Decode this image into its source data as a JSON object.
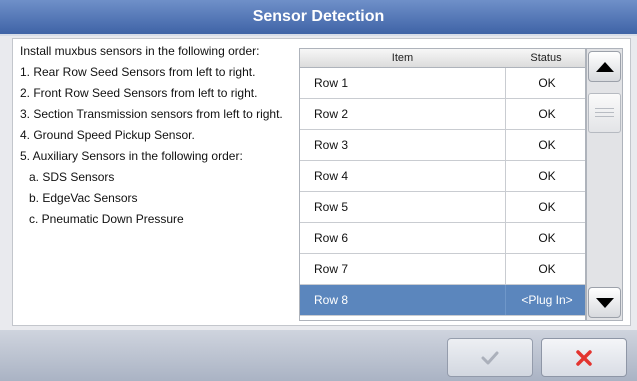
{
  "dialog": {
    "title": "Sensor Detection"
  },
  "instructions": {
    "heading": "Install muxbus sensors in the following order:",
    "steps": [
      "1. Rear Row Seed Sensors from left to right.",
      "2. Front Row Seed Sensors from left to right.",
      "3. Section Transmission sensors from left to right.",
      "4. Ground Speed Pickup Sensor.",
      "5. Auxiliary Sensors in the following order:"
    ],
    "substeps": [
      "a. SDS Sensors",
      "b. EdgeVac Sensors",
      "c. Pneumatic Down Pressure"
    ]
  },
  "table": {
    "headers": {
      "item": "Item",
      "status": "Status"
    },
    "rows": [
      {
        "item": "Row 1",
        "status": "OK"
      },
      {
        "item": "Row 2",
        "status": "OK"
      },
      {
        "item": "Row 3",
        "status": "OK"
      },
      {
        "item": "Row 4",
        "status": "OK"
      },
      {
        "item": "Row 5",
        "status": "OK"
      },
      {
        "item": "Row 6",
        "status": "OK"
      },
      {
        "item": "Row 7",
        "status": "OK"
      },
      {
        "item": "Row 8",
        "status": "<Plug In>"
      }
    ],
    "selected_row": "Row 8"
  },
  "icons": {
    "scroll_up": "arrow-up-icon",
    "scroll_down": "arrow-down-icon",
    "accept": "checkmark-icon",
    "cancel": "x-icon"
  },
  "colors": {
    "title_bar": "#4a6fb0",
    "selected_row": "#5b86bd",
    "cancel_icon": "#e3342f",
    "accept_icon_disabled": "#a9aeb8"
  }
}
